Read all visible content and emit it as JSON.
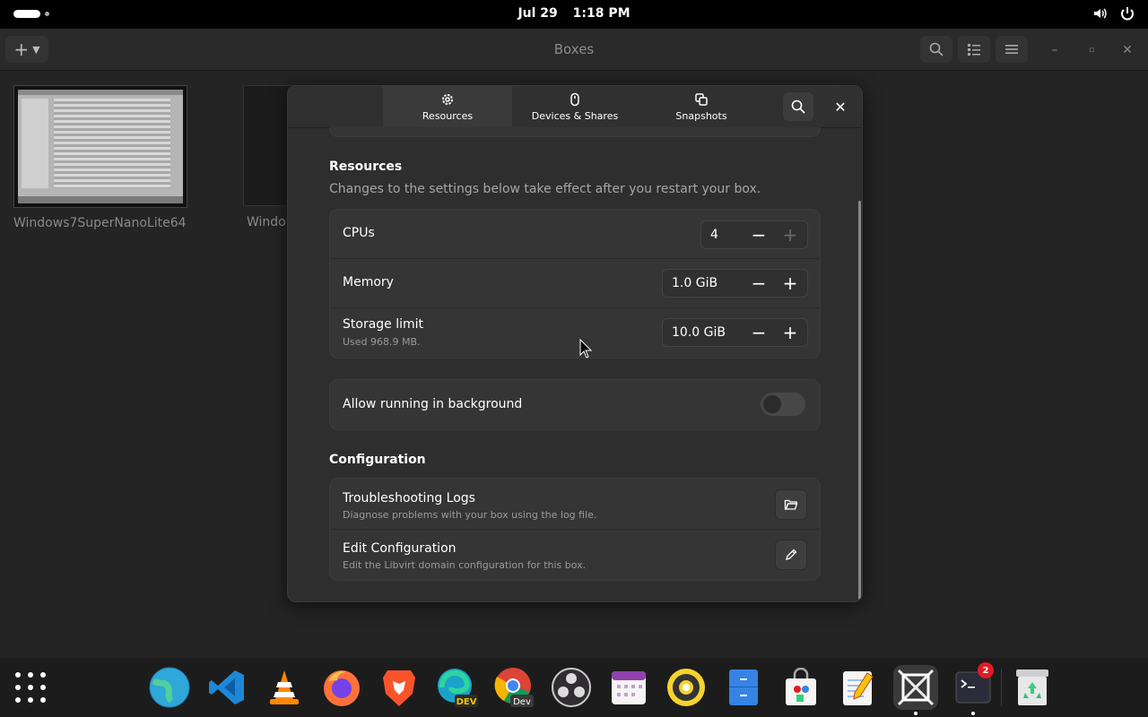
{
  "topbar": {
    "date": "Jul 29",
    "time": "1:18 PM"
  },
  "boxes": {
    "title": "Boxes",
    "machines": [
      {
        "name": "Windows7SuperNanoLite64"
      },
      {
        "name": "Windo"
      }
    ]
  },
  "dialog": {
    "tabs": [
      {
        "label": "Resources",
        "icon": "gear-icon",
        "active": true
      },
      {
        "label": "Devices & Shares",
        "icon": "mouse-icon",
        "active": false
      },
      {
        "label": "Snapshots",
        "icon": "snapshot-icon",
        "active": false
      }
    ],
    "resources": {
      "title": "Resources",
      "description": "Changes to the settings below take effect after you restart your box.",
      "cpus": {
        "label": "CPUs",
        "value": "4"
      },
      "memory": {
        "label": "Memory",
        "value": "1.0 GiB"
      },
      "storage": {
        "label": "Storage limit",
        "sub": "Used 968.9 MB.",
        "value": "10.0 GiB"
      },
      "background": {
        "label": "Allow running in background",
        "enabled": false
      }
    },
    "configuration": {
      "title": "Configuration",
      "logs": {
        "label": "Troubleshooting Logs",
        "sub": "Diagnose problems with your box using the log file."
      },
      "edit": {
        "label": "Edit Configuration",
        "sub": "Edit the Libvirt domain configuration for this box."
      }
    }
  },
  "dock": {
    "apps": [
      "Web Browser",
      "Visual Studio Code",
      "VLC",
      "Firefox",
      "Brave",
      "Edge Dev",
      "Chrome Dev",
      "OBS Studio",
      "Calendar",
      "Rhythmbox",
      "Files",
      "Software",
      "Text Editor",
      "Boxes",
      "Terminal",
      "Trash"
    ],
    "terminal_badge": "2"
  },
  "colors": {
    "accent": "#3584e4",
    "badge": "#e01b24",
    "window_bg": "#2e2e2e"
  }
}
